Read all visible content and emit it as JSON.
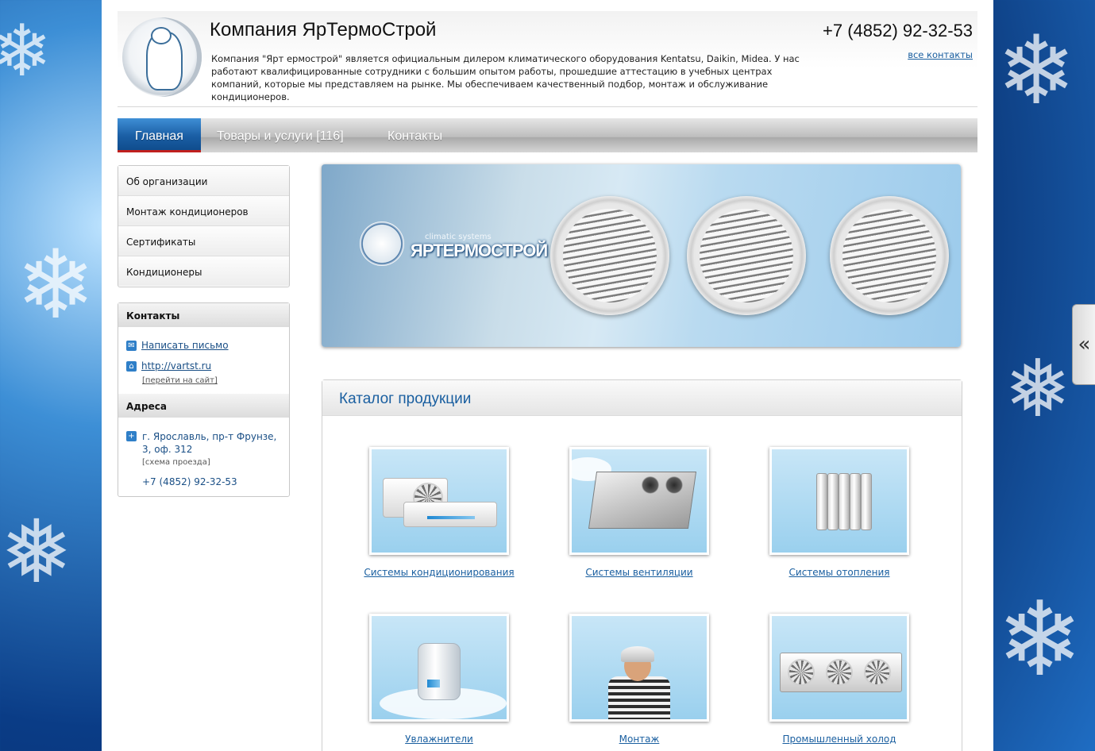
{
  "header": {
    "company_title": "Компания ЯрТермоСтрой",
    "description": "Компания \"Ярт ермострой\" является официальным дилером климатического оборудования Kentatsu, Daikin, Midea. У нас работают квалифицированные сотрудники с большим опытом работы, прошедшие аттестацию в учебных центрах компаний, которые мы представляем на рынке. Мы обеспечиваем качественный подбор, монтаж и обслуживание кондиционеров.",
    "phone": "+7 (4852) 92-32-53",
    "all_contacts": "все контакты"
  },
  "nav": {
    "items": [
      {
        "label": "Главная",
        "active": true
      },
      {
        "label": "Товары и услуги [116]",
        "active": false
      },
      {
        "label": "Контакты",
        "active": false
      }
    ]
  },
  "sidebar": {
    "menu": [
      "Об организации",
      "Монтаж кондиционеров",
      "Сертификаты",
      "Кондиционеры"
    ],
    "contacts": {
      "title": "Контакты",
      "email_link": "Написать письмо",
      "site_link": "http://vartst.ru",
      "site_sub": "[перейти на сайт]"
    },
    "addresses": {
      "title": "Адреса",
      "address": "г. Ярославль, пр-т Фрунзе, 3, оф. 312",
      "map_link": "[схема проезда]",
      "phone": "+7 (4852) 92-32-53"
    }
  },
  "banner": {
    "brand": "ЯРТЕРМОСТРОЙ",
    "tagline": "climatic systems"
  },
  "catalog": {
    "title": "Каталог продукции",
    "items": [
      "Системы кондиционирования",
      "Системы вентиляции",
      "Системы отопления",
      "Увлажнители",
      "Монтаж",
      "Промышленный холод"
    ]
  },
  "side_tab": {
    "label": "«"
  },
  "colors": {
    "accent": "#1a5fa0",
    "nav_active": "#1b5fa5",
    "nav_underline": "#c0201e"
  }
}
